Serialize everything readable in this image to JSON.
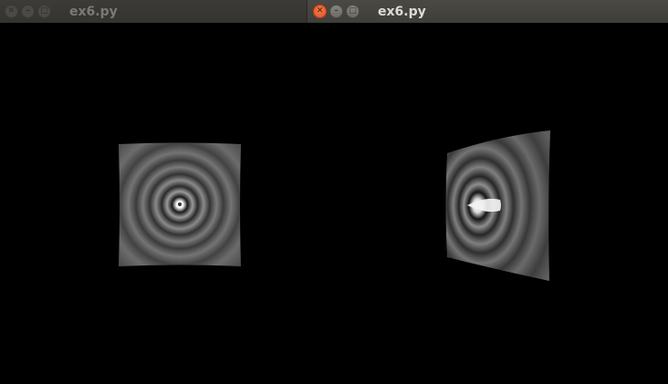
{
  "windows": [
    {
      "title": "ex6.py",
      "active": false,
      "controls": [
        "close-icon",
        "minimize-icon",
        "maximize-icon"
      ],
      "scene": "flat ripple texture on square"
    },
    {
      "title": "ex6.py",
      "active": true,
      "controls": [
        "close-icon",
        "minimize-icon",
        "maximize-icon"
      ],
      "scene": "rippled surface viewed at an angle"
    }
  ],
  "colors": {
    "close_active": "#e95420",
    "titlebar_inactive": "#3c3b37",
    "titlebar_active": "#4a4944",
    "canvas": "#000000"
  }
}
